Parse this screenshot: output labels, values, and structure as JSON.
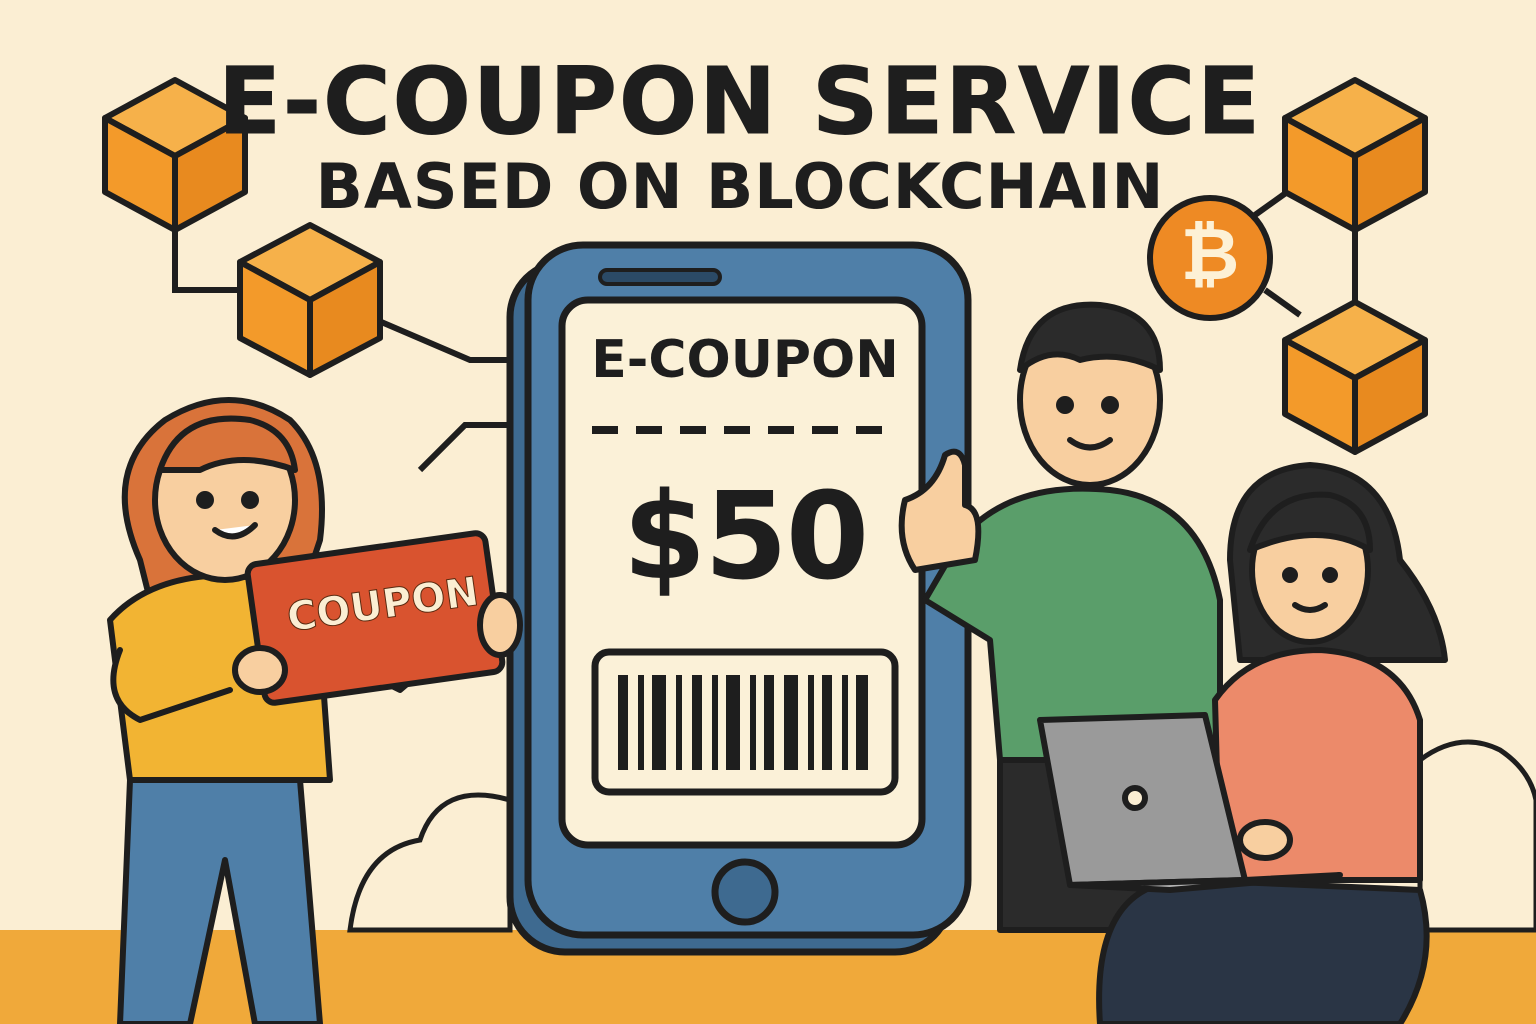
{
  "title": {
    "main": "E-COUPON SERVICE",
    "sub": "BASED ON BLOCKCHAIN"
  },
  "phone_coupon": {
    "label": "E-COUPON",
    "amount": "$50"
  },
  "held_coupon": {
    "text": "COUPON"
  },
  "bitcoin_badge": {
    "symbol": "₿"
  },
  "colors": {
    "background": "#fbeed3",
    "ground": "#f0a93a",
    "block_orange": "#f39a2a",
    "phone_blue": "#4f7fa8",
    "screen_cream": "#fbf1d8",
    "coupon_red": "#d9532f",
    "outline": "#1e1e1e"
  }
}
